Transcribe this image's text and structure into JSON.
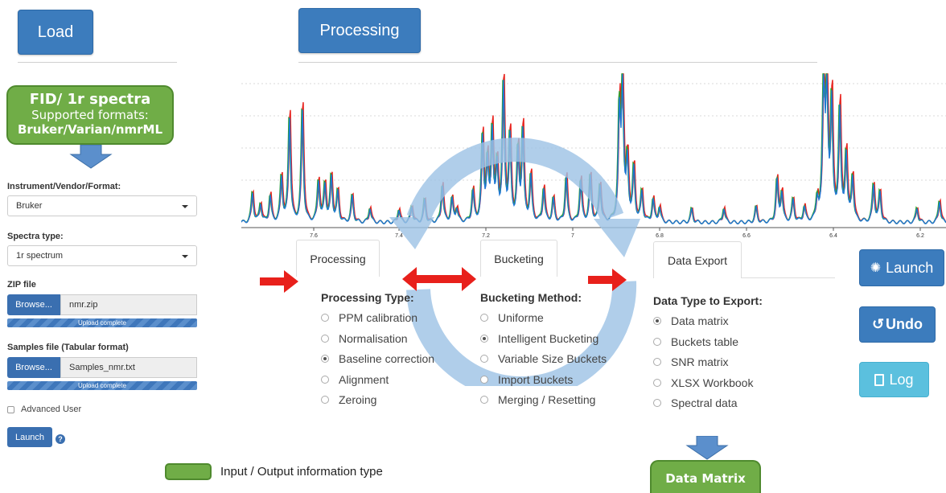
{
  "header": {
    "load_label": "Load",
    "processing_label": "Processing"
  },
  "input_box": {
    "title": "FID/ 1r spectra",
    "line2": "Supported formats:",
    "line3": "Bruker/Varian/nmrML"
  },
  "form": {
    "instrument_label": "Instrument/Vendor/Format:",
    "instrument_value": "Bruker",
    "spectra_type_label": "Spectra type:",
    "spectra_type_value": "1r spectrum",
    "zip_label": "ZIP file",
    "zip_browse": "Browse...",
    "zip_filename": "nmr.zip",
    "zip_progress_text": "Upload complete",
    "zip_progress": 1.0,
    "samples_label": "Samples file (Tabular format)",
    "samples_browse": "Browse...",
    "samples_filename": "Samples_nmr.txt",
    "samples_progress_text": "Upload complete",
    "samples_progress": 1.0,
    "advanced_label": "Advanced User",
    "advanced_checked": false,
    "launch_label": "Launch",
    "help_glyph": "?"
  },
  "spectrum_axis": {
    "ticks": [
      "7.6",
      "7.4",
      "7.2",
      "7",
      "6.8",
      "6.6",
      "6.4",
      "6.2"
    ]
  },
  "tabs": {
    "processing": "Processing",
    "bucketing": "Bucketing",
    "export": "Data Export"
  },
  "processing": {
    "title": "Processing Type:",
    "options": [
      "PPM calibration",
      "Normalisation",
      "Baseline correction",
      "Alignment",
      "Zeroing"
    ],
    "selected": "Baseline correction"
  },
  "bucketing": {
    "title": "Bucketing Method:",
    "options": [
      "Uniforme",
      "Intelligent Bucketing",
      "Variable Size Buckets",
      "Import Buckets",
      "Merging / Resetting"
    ],
    "selected": "Intelligent Bucketing"
  },
  "export": {
    "title": "Data Type to Export:",
    "options": [
      "Data matrix",
      "Buckets table",
      "SNR matrix",
      "XLSX Workbook",
      "Spectral data"
    ],
    "selected": "Data matrix"
  },
  "side_buttons": {
    "launch": "Launch",
    "undo": "Undo",
    "log": "Log"
  },
  "output_box": {
    "label": "Data Matrix"
  },
  "legend": {
    "label": "Input / Output information type"
  },
  "colors": {
    "button_blue": "#3c7cbd",
    "green": "#70ad47",
    "log_cyan": "#5bc0de",
    "arrow_red": "#e8201b",
    "cycle_arrow": "#9dc3e6"
  },
  "icons": [
    "caret-down-icon",
    "help-icon",
    "spinner-icon",
    "undo-icon",
    "document-icon",
    "down-arrow-icon",
    "red-arrow-icon",
    "cycle-arrow-icon"
  ]
}
